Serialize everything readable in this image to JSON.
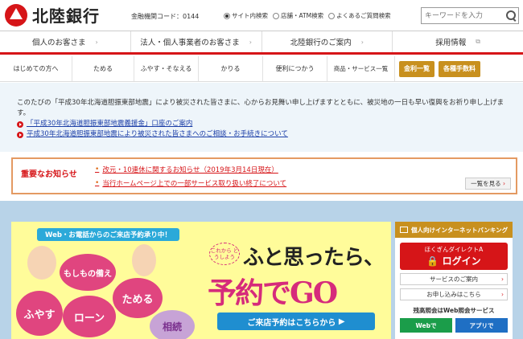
{
  "header": {
    "logo_text": "北陸銀行",
    "bank_code": "金融機関コード：0144",
    "search_options": [
      "サイト内検索",
      "店舗・ATM検索",
      "よくあるご質問検索"
    ],
    "search_placeholder": "キーワードを入力"
  },
  "main_nav": [
    "個人のお客さま",
    "法人・個人事業者のお客さま",
    "北陸銀行のご案内",
    "採用情報"
  ],
  "sub_nav": [
    "はじめての方へ",
    "ためる",
    "ふやす・そなえる",
    "かりる",
    "便利につかう",
    "商品・サービス一覧"
  ],
  "sub_buttons": [
    "金利一覧",
    "各種手数料"
  ],
  "notice": {
    "text": "このたびの「平成30年北海道胆振東部地震」により被災された皆さまに、心からお見舞い申し上げますとともに、被災地の一日も早い復興をお祈り申し上げます。",
    "links": [
      "「平成30年北海道胆振東部地震義援金」口座のご案内",
      "平成30年北海道胆振東部地震により被災された皆さまへのご相談・お手続きについて"
    ]
  },
  "important": {
    "title": "重要なお知らせ",
    "items": [
      "改元・10連休に関するお知らせ（2019年3月14日現在）",
      "当行ホームページ上での一部サービス取り扱い終了について"
    ],
    "more": "一覧を見る"
  },
  "banner": {
    "tab": "Web・お電話からのご来店予約承り中！",
    "cloud_labels": [
      "もしもの備え",
      "ためる",
      "ふやす",
      "ローン",
      "相続"
    ],
    "circle_text": "これから どうしよう",
    "headline1": "ふと思ったら、",
    "headline2": "予約でGO",
    "button": "ご来店予約はこちらから"
  },
  "sidebar": {
    "head": "個人向けインターネットバンキング",
    "login_sub": "ほくぎんダイレクトA",
    "login": "ログイン",
    "links": [
      "サービスのご案内",
      "お申し込みはこちら"
    ],
    "sub_title": "残高照会はWeb照会サービス",
    "apps": [
      "Webで",
      "アプリで"
    ]
  },
  "colors": {
    "brand_red": "#d61518",
    "gold": "#c8901e",
    "link_blue": "#1c3fa8"
  }
}
